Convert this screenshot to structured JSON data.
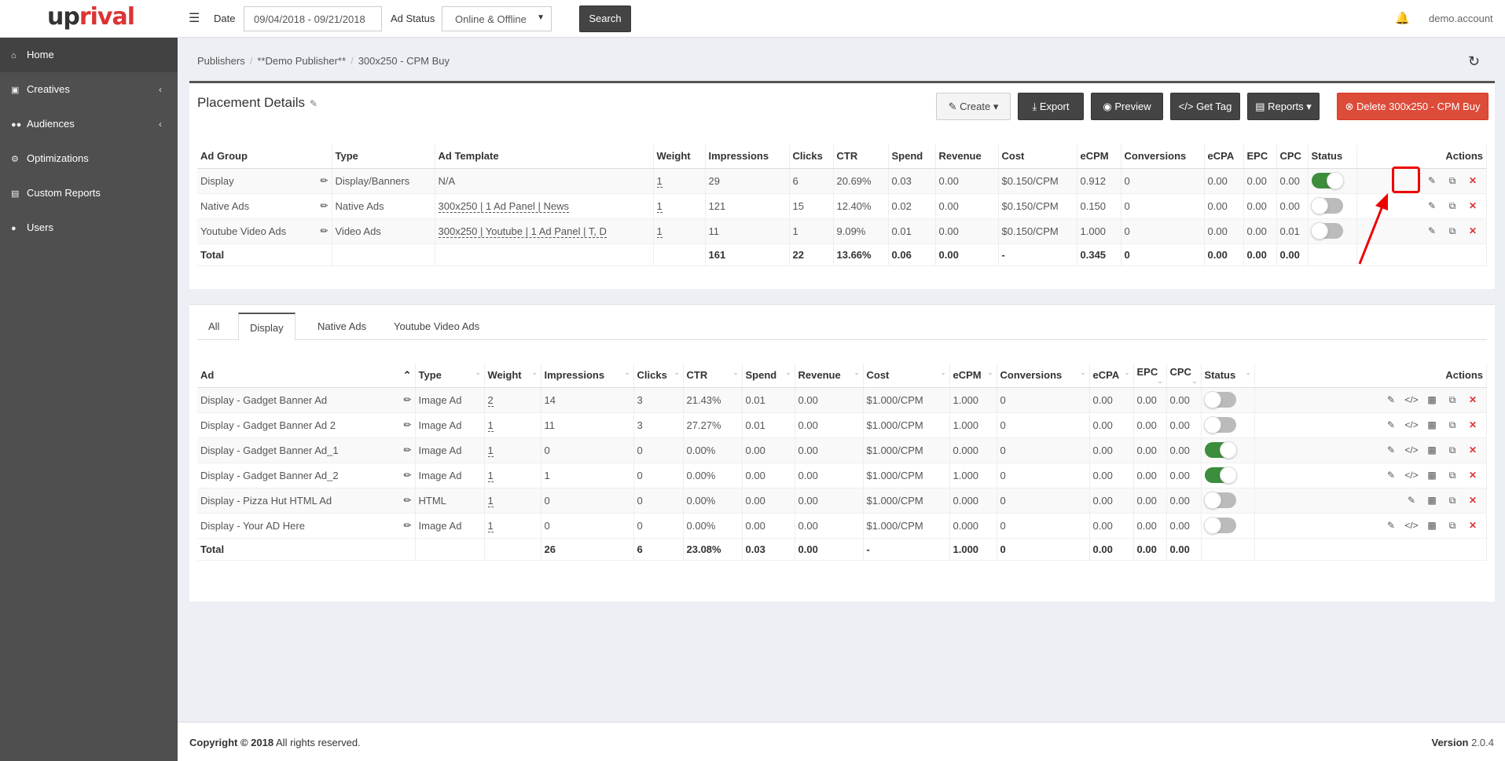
{
  "topbar": {
    "logo_up": "up",
    "logo_rival": "rival",
    "date_label": "Date",
    "date_value": "09/04/2018 - 09/21/2018",
    "status_label": "Ad Status",
    "status_value": "Online & Offline",
    "search_label": "Search",
    "account": "demo.account"
  },
  "sidebar": {
    "items": [
      {
        "label": "Home",
        "icon": "home-icon"
      },
      {
        "label": "Creatives",
        "icon": "image-icon"
      },
      {
        "label": "Audiences",
        "icon": "users-icon"
      },
      {
        "label": "Optimizations",
        "icon": "gears-icon"
      },
      {
        "label": "Custom Reports",
        "icon": "file-icon"
      },
      {
        "label": "Users",
        "icon": "user-icon"
      }
    ]
  },
  "breadcrumb": [
    "Publishers",
    "**Demo Publisher**",
    "300x250 - CPM Buy"
  ],
  "placement": {
    "title": "Placement Details",
    "buttons": {
      "create": "Create",
      "export": "Export",
      "preview": "Preview",
      "get_tag": "Get Tag",
      "reports": "Reports",
      "delete": "Delete 300x250 - CPM Buy"
    },
    "columns": [
      "Ad Group",
      "Type",
      "Ad Template",
      "Weight",
      "Impressions",
      "Clicks",
      "CTR",
      "Spend",
      "Revenue",
      "Cost",
      "eCPM",
      "Conversions",
      "eCPA",
      "EPC",
      "CPC",
      "Status",
      "Actions"
    ],
    "rows": [
      {
        "group": "Display",
        "type": "Display/Banners",
        "template": "N/A",
        "weight": "1",
        "impressions": "29",
        "clicks": "6",
        "ctr": "20.69%",
        "spend": "0.03",
        "revenue": "0.00",
        "cost": "$0.150/CPM",
        "ecpm": "0.912",
        "conversions": "0",
        "ecpa": "0.00",
        "epc": "0.00",
        "cpc": "0.00"
      },
      {
        "group": "Native Ads",
        "type": "Native Ads",
        "template": "300x250 | 1 Ad Panel | News",
        "weight": "1",
        "impressions": "121",
        "clicks": "15",
        "ctr": "12.40%",
        "spend": "0.02",
        "revenue": "0.00",
        "cost": "$0.150/CPM",
        "ecpm": "0.150",
        "conversions": "0",
        "ecpa": "0.00",
        "epc": "0.00",
        "cpc": "0.00"
      },
      {
        "group": "Youtube Video Ads",
        "type": "Video Ads",
        "template": "300x250 | Youtube | 1 Ad Panel | T, D",
        "weight": "1",
        "impressions": "11",
        "clicks": "1",
        "ctr": "9.09%",
        "spend": "0.01",
        "revenue": "0.00",
        "cost": "$0.150/CPM",
        "ecpm": "1.000",
        "conversions": "0",
        "ecpa": "0.00",
        "epc": "0.00",
        "cpc": "0.01"
      }
    ],
    "total": {
      "label": "Total",
      "impressions": "161",
      "clicks": "22",
      "ctr": "13.66%",
      "spend": "0.06",
      "revenue": "0.00",
      "cost": "-",
      "ecpm": "0.345",
      "conversions": "0",
      "ecpa": "0.00",
      "epc": "0.00",
      "cpc": "0.00"
    }
  },
  "ads": {
    "tabs": [
      "All",
      "Display",
      "Native Ads",
      "Youtube Video Ads"
    ],
    "columns": [
      "Ad",
      "Type",
      "Weight",
      "Impressions",
      "Clicks",
      "CTR",
      "Spend",
      "Revenue",
      "Cost",
      "eCPM",
      "Conversions",
      "eCPA",
      "EPC",
      "CPC",
      "Status",
      "Actions"
    ],
    "rows": [
      {
        "ad": "Display - Gadget Banner Ad",
        "type": "Image Ad",
        "weight": "2",
        "impressions": "14",
        "clicks": "3",
        "ctr": "21.43%",
        "spend": "0.01",
        "revenue": "0.00",
        "cost": "$1.000/CPM",
        "ecpm": "1.000",
        "conversions": "0",
        "ecpa": "0.00",
        "epc": "0.00",
        "cpc": "0.00"
      },
      {
        "ad": "Display - Gadget Banner Ad 2",
        "type": "Image Ad",
        "weight": "1",
        "impressions": "11",
        "clicks": "3",
        "ctr": "27.27%",
        "spend": "0.01",
        "revenue": "0.00",
        "cost": "$1.000/CPM",
        "ecpm": "1.000",
        "conversions": "0",
        "ecpa": "0.00",
        "epc": "0.00",
        "cpc": "0.00"
      },
      {
        "ad": "Display - Gadget Banner Ad_1",
        "type": "Image Ad",
        "weight": "1",
        "impressions": "0",
        "clicks": "0",
        "ctr": "0.00%",
        "spend": "0.00",
        "revenue": "0.00",
        "cost": "$1.000/CPM",
        "ecpm": "0.000",
        "conversions": "0",
        "ecpa": "0.00",
        "epc": "0.00",
        "cpc": "0.00"
      },
      {
        "ad": "Display - Gadget Banner Ad_2",
        "type": "Image Ad",
        "weight": "1",
        "impressions": "1",
        "clicks": "0",
        "ctr": "0.00%",
        "spend": "0.00",
        "revenue": "0.00",
        "cost": "$1.000/CPM",
        "ecpm": "1.000",
        "conversions": "0",
        "ecpa": "0.00",
        "epc": "0.00",
        "cpc": "0.00"
      },
      {
        "ad": "Display - Pizza Hut HTML Ad",
        "type": "HTML",
        "weight": "1",
        "impressions": "0",
        "clicks": "0",
        "ctr": "0.00%",
        "spend": "0.00",
        "revenue": "0.00",
        "cost": "$1.000/CPM",
        "ecpm": "0.000",
        "conversions": "0",
        "ecpa": "0.00",
        "epc": "0.00",
        "cpc": "0.00"
      },
      {
        "ad": "Display - Your AD Here",
        "type": "Image Ad",
        "weight": "1",
        "impressions": "0",
        "clicks": "0",
        "ctr": "0.00%",
        "spend": "0.00",
        "revenue": "0.00",
        "cost": "$1.000/CPM",
        "ecpm": "0.000",
        "conversions": "0",
        "ecpa": "0.00",
        "epc": "0.00",
        "cpc": "0.00"
      }
    ],
    "total": {
      "label": "Total",
      "impressions": "26",
      "clicks": "6",
      "ctr": "23.08%",
      "spend": "0.03",
      "revenue": "0.00",
      "cost": "-",
      "ecpm": "1.000",
      "conversions": "0",
      "ecpa": "0.00",
      "epc": "0.00",
      "cpc": "0.00"
    }
  },
  "footer": {
    "copyright_bold": "Copyright © 2018",
    "copyright_rest": "All rights reserved.",
    "version_label": "Version",
    "version_value": "2.0.4"
  },
  "colors": {
    "brand_red": "#dd3333",
    "sidebar_bg": "#4f4f4f",
    "toggle_on": "#3c8d3c",
    "delete_btn": "#dd4b39"
  }
}
